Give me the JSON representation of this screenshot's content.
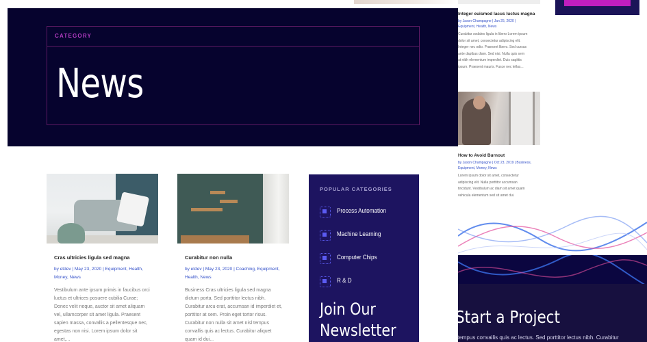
{
  "hero": {
    "category": "CATEGORY",
    "title": "News"
  },
  "right_posts": [
    {
      "title": "Integer euismod lacus luctus magna",
      "meta": [
        "by Jason Champagne | Jan 25, 2020 |",
        "Equipment, Health, News"
      ],
      "excerpt": [
        "Curabitur sodales ligula in libero Lorem ipsum",
        "dolor sit amet, consectetur adipiscing elit.",
        "Integer nec odio. Praesent libero. Sed cursus",
        "ante dapibus diam. Sed nisi. Nulla quis sem",
        "at nibh elementum imperdiet. Duis sagittis",
        "ipsum. Praesent mauris. Fusce nec tellus..."
      ]
    },
    {
      "title": "How to Avoid Burnout",
      "meta": [
        "by Jason Champagne | Oct 23, 2019 | Business,",
        "Equipment, Money, News"
      ],
      "excerpt": [
        "Lorem ipsum dolor sit amet, consectetur",
        "adipiscing elit. Nulla porttitor accumsan",
        "tincidunt. Vestibulum ac diam sit amet quam",
        "vehicula elementum sed sit amet dui."
      ]
    }
  ],
  "posts": [
    {
      "title": "Cras ultricies ligula sed magna",
      "meta": [
        "by etdev | May 23, 2020 | Equipment, Health,",
        "Money, News"
      ],
      "excerpt": [
        "Vestibulum ante ipsum primis in faucibus orci",
        "luctus et ultrices posuere cubilia Curae;",
        "Donec velit neque, auctor sit amet aliquam",
        "vel, ullamcorper sit amet ligula. Praesent",
        "sapien massa, convallis a pellentesque nec,",
        "egestas non nisi. Lorem ipsum dolor sit",
        "amet,..."
      ]
    },
    {
      "title": "Curabitur non nulla",
      "meta": [
        "by etdev | May 23, 2020 | Coaching, Equipment,",
        "Health, News"
      ],
      "excerpt": [
        "Business Cras ultricies ligula sed magna",
        "dictum porta. Sed porttitor lectus nibh.",
        "Curabitur arcu erat, accumsan id imperdiet et,",
        "porttitor at sem. Proin eget tortor risus.",
        "Curabitur non nulla sit amet nisl tempus",
        "convallis quis ac lectus. Curabitur aliquet",
        "quam id dui..."
      ]
    }
  ],
  "sidebar": {
    "heading": "POPULAR CATEGORIES",
    "items": [
      "Process Automation",
      "Machine Learning",
      "Computer Chips",
      "R & D"
    ],
    "newsletter": [
      "Join Our",
      "Newsletter"
    ]
  },
  "cta": {
    "title": "Start a Project",
    "text": "tempus convallis quis ac lectus. Sed porttitor lectus nibh. Curabitur"
  },
  "colors": {
    "hero_bg": "#06032e",
    "sidebar_bg": "#1d1460",
    "accent": "#c11ebf",
    "link": "#3451c9"
  }
}
